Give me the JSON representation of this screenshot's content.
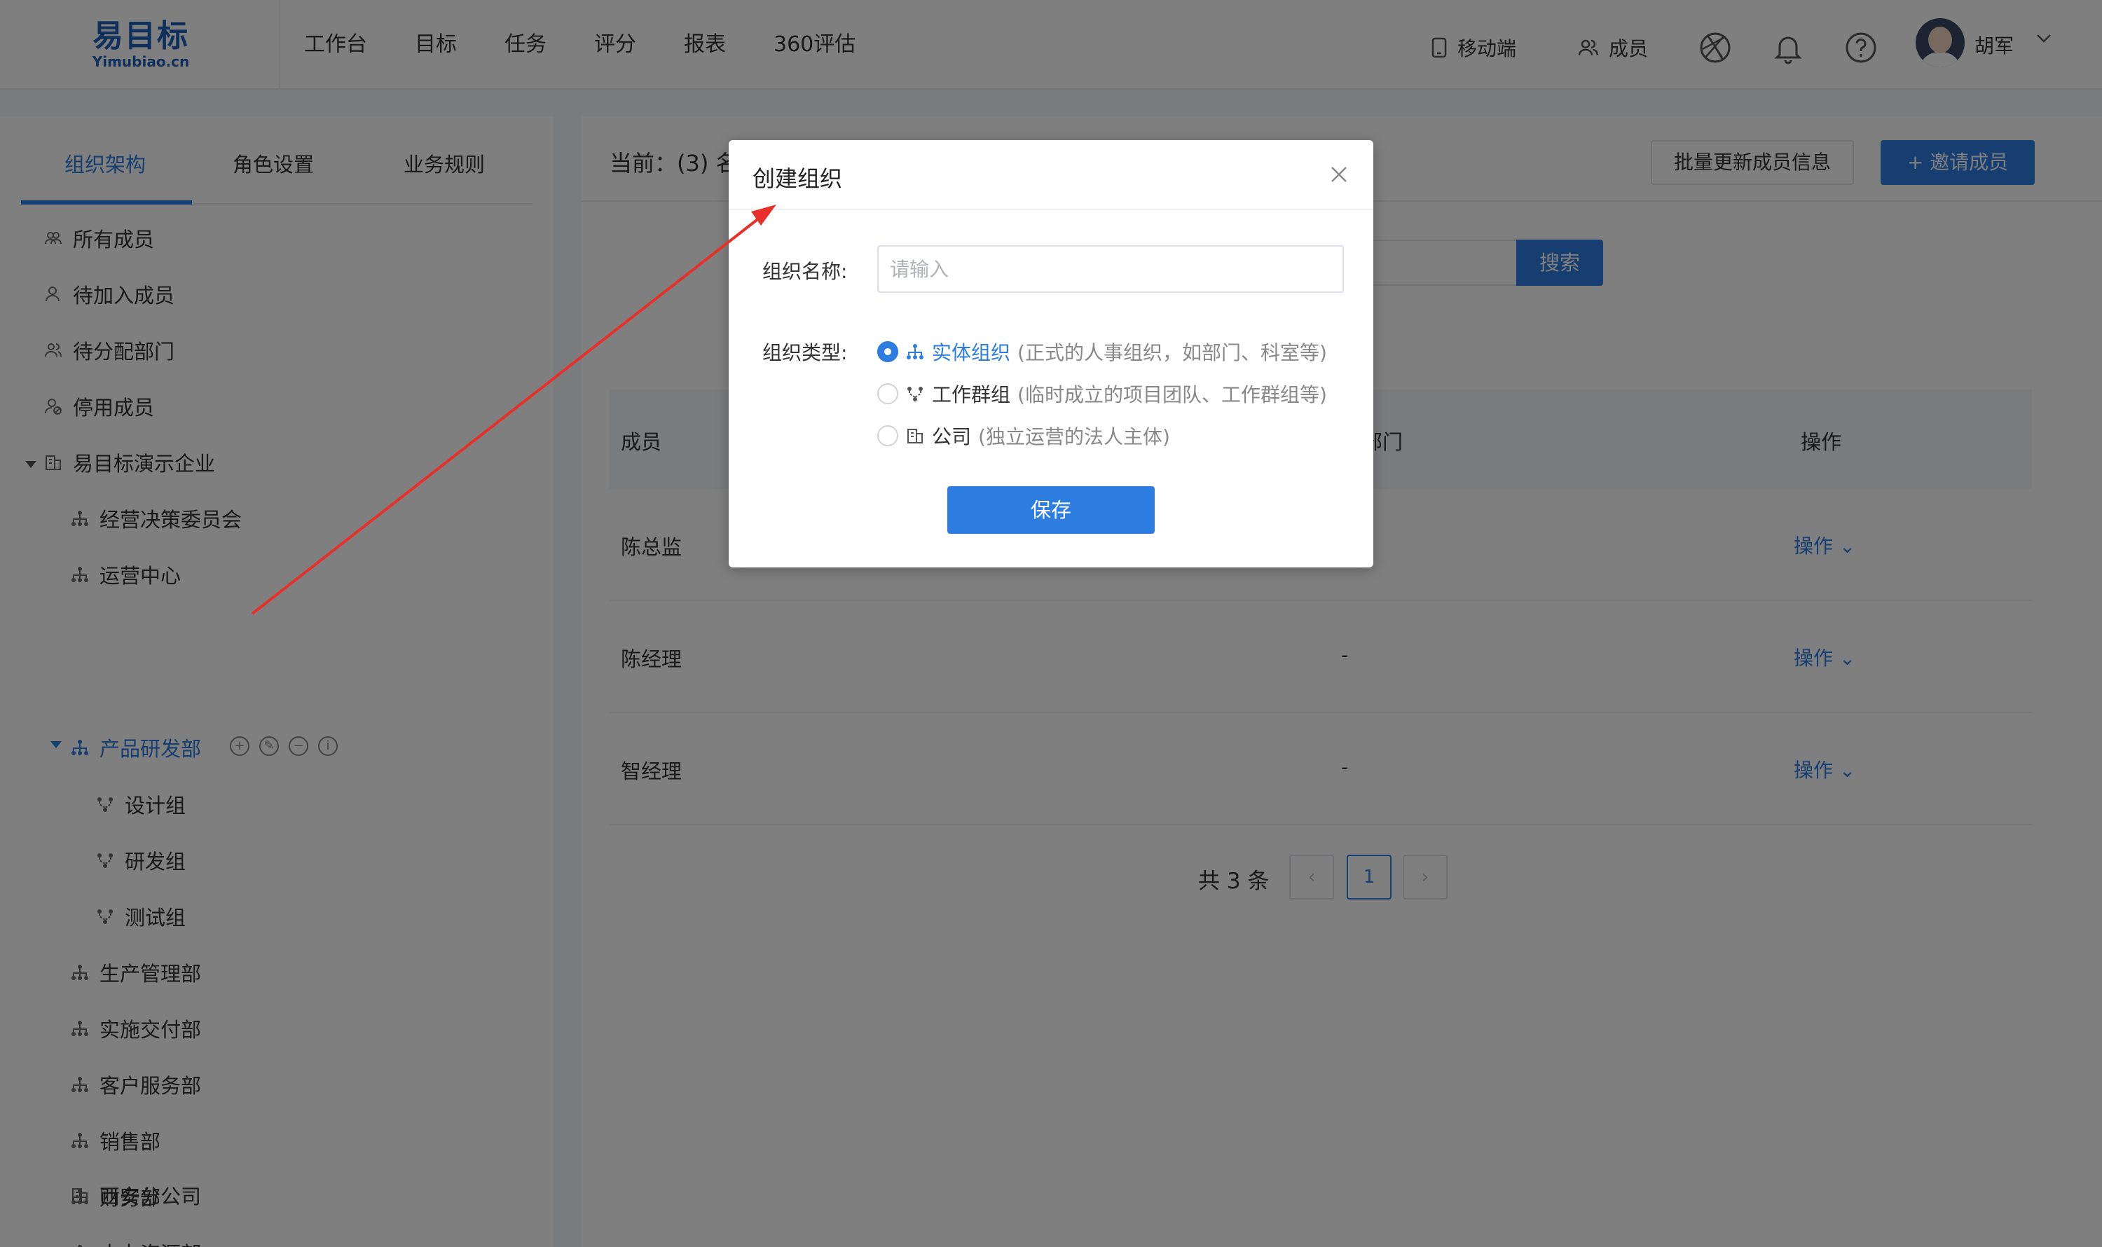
{
  "header": {
    "logo_cn": "易目标",
    "logo_en": "Yimubiao.cn",
    "nav": [
      "工作台",
      "目标",
      "任务",
      "评分",
      "报表",
      "360评估"
    ],
    "mobile_label": "移动端",
    "members_label": "成员",
    "user_name": "胡军"
  },
  "sidebar": {
    "tabs": [
      "组织架构",
      "角色设置",
      "业务规则"
    ],
    "items": [
      {
        "label": "所有成员",
        "icon": "members-icon"
      },
      {
        "label": "待加入成员",
        "icon": "user-icon"
      },
      {
        "label": "待分配部门",
        "icon": "users-icon"
      },
      {
        "label": "停用成员",
        "icon": "user-disabled-icon"
      },
      {
        "label": "易目标演示企业",
        "icon": "building-icon"
      },
      {
        "label": "经营决策委员会",
        "icon": "org-icon"
      },
      {
        "label": "运营中心",
        "icon": "org-icon"
      },
      {
        "label": "产品研发部",
        "icon": "org-icon"
      },
      {
        "label": "设计组",
        "icon": "group-icon"
      },
      {
        "label": "研发组",
        "icon": "group-icon"
      },
      {
        "label": "测试组",
        "icon": "group-icon"
      },
      {
        "label": "生产管理部",
        "icon": "org-icon"
      },
      {
        "label": "实施交付部",
        "icon": "org-icon"
      },
      {
        "label": "客户服务部",
        "icon": "org-icon"
      },
      {
        "label": "销售部",
        "icon": "org-icon"
      },
      {
        "label": "财务部",
        "icon": "org-icon"
      },
      {
        "label": "人力资源部",
        "icon": "org-icon"
      },
      {
        "label": "西安分公司",
        "icon": "building-icon"
      }
    ]
  },
  "main": {
    "current_title": "当前：(3) 名",
    "batch_update_label": "批量更新成员信息",
    "invite_label": "+  邀请成员",
    "search_label": "搜索",
    "columns": {
      "member": "成员",
      "dept": "部门",
      "ops": "操作"
    },
    "rows": [
      {
        "name": "陈总监",
        "dept": "",
        "op": "操作"
      },
      {
        "name": "陈经理",
        "dept": "-",
        "op": "操作"
      },
      {
        "name": "智经理",
        "dept": "-",
        "op": "操作"
      }
    ],
    "pager": {
      "total": "共 3 条",
      "prev": "‹",
      "page": "1",
      "next": "›"
    }
  },
  "dialog": {
    "title": "创建组织",
    "name_label": "组织名称:",
    "name_placeholder": "请输入",
    "type_label": "组织类型:",
    "options": [
      {
        "label": "实体组织",
        "desc": "(正式的人事组织，如部门、科室等)",
        "selected": true
      },
      {
        "label": "工作群组",
        "desc": "(临时成立的项目团队、工作群组等)",
        "selected": false
      },
      {
        "label": "公司",
        "desc": "(独立运营的法人主体)",
        "selected": false
      }
    ],
    "save_label": "保存"
  },
  "colors": {
    "accent": "#2d7de0",
    "annotation_arrow": "#e8302a"
  }
}
